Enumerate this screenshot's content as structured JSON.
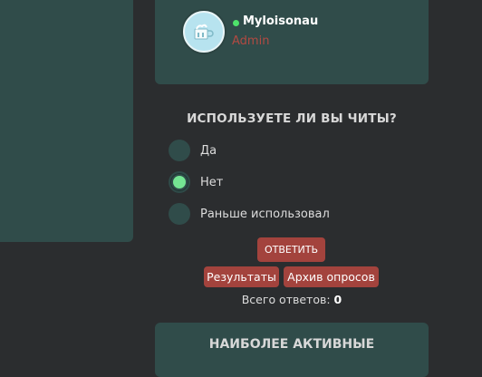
{
  "user": {
    "name": "Myloisonau",
    "role": "Admin",
    "status_color": "#4ee36b",
    "avatar_icon": "avatar-icon"
  },
  "poll": {
    "title": "ИСПОЛЬЗУЕТЕ ЛИ ВЫ ЧИТЫ?",
    "options": [
      {
        "label": "Да",
        "selected": false
      },
      {
        "label": "Нет",
        "selected": true
      },
      {
        "label": "Раньше использовал",
        "selected": false
      }
    ],
    "vote_label": "ОТВЕТИТЬ",
    "results_label": "Результаты",
    "archive_label": "Архив опросов",
    "total_label": "Всего ответов:",
    "total_value": "0"
  },
  "active": {
    "title": "НАИБОЛЕЕ АКТИВНЫЕ"
  },
  "colors": {
    "background": "#2b2d2f",
    "panel": "#304c4a",
    "accent": "#a3433d",
    "selected": "#74e593"
  }
}
